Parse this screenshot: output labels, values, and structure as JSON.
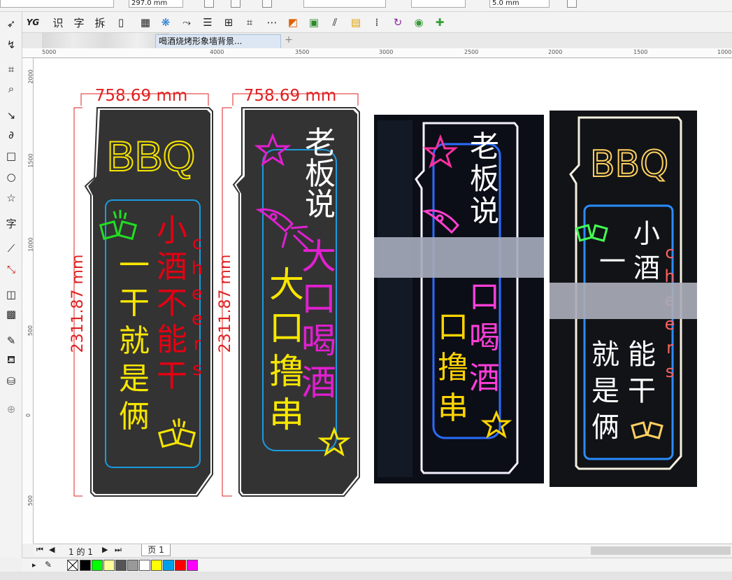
{
  "property_bar": {
    "height_value": "297.0 mm",
    "nudge_value": "5.0 mm"
  },
  "toolbar": {
    "text_tool_1": "识",
    "text_tool_2": "字",
    "text_tool_3": "拆"
  },
  "document": {
    "tab_title": "喝酒烧烤形象墙背景...",
    "add_tab": "+"
  },
  "ruler": {
    "h_ticks": [
      "5000",
      "4000",
      "3500",
      "3000",
      "2500",
      "2000",
      "1500",
      "1000"
    ],
    "v_ticks": [
      "2000",
      "1500",
      "1000",
      "500",
      "0",
      "500"
    ]
  },
  "design1": {
    "width_dim": "758.69 mm",
    "height_dim": "2311.87 mm",
    "title": "BBQ",
    "col_left": "一干就是俩",
    "col_right": "小酒不能干",
    "cheers": "cheers"
  },
  "design2": {
    "width_dim": "758.69 mm",
    "height_dim": "2311.87 mm",
    "header": "老板说",
    "col_left": "大口撸串",
    "col_right": "大口喝酒"
  },
  "photo1": {
    "header": "老板说",
    "col_left": "口撸串",
    "col_right": "口喝酒"
  },
  "photo2": {
    "title": "BBQ",
    "top_right": "小",
    "top_left": "一",
    "top_mid": "酒",
    "col_left": "就是俩",
    "col_right": "能干",
    "cheers": "cheers"
  },
  "page_nav": {
    "page_counter": "1 的 1",
    "page_tab": "页 1"
  },
  "palette": {
    "colors": [
      "#000000",
      "#00ff00",
      "#ffff99",
      "#555555",
      "#999999",
      "#ffffff",
      "#ffff00",
      "#00a0e9",
      "#ff0000",
      "#ff00ff"
    ]
  },
  "colors": {
    "neon_yellow": "#f7e600",
    "neon_red": "#e60012",
    "neon_blue": "#1a9be0",
    "neon_magenta": "#e020d0",
    "neon_green": "#22dd22",
    "panel": "#333333",
    "dim_red": "#e02020"
  }
}
